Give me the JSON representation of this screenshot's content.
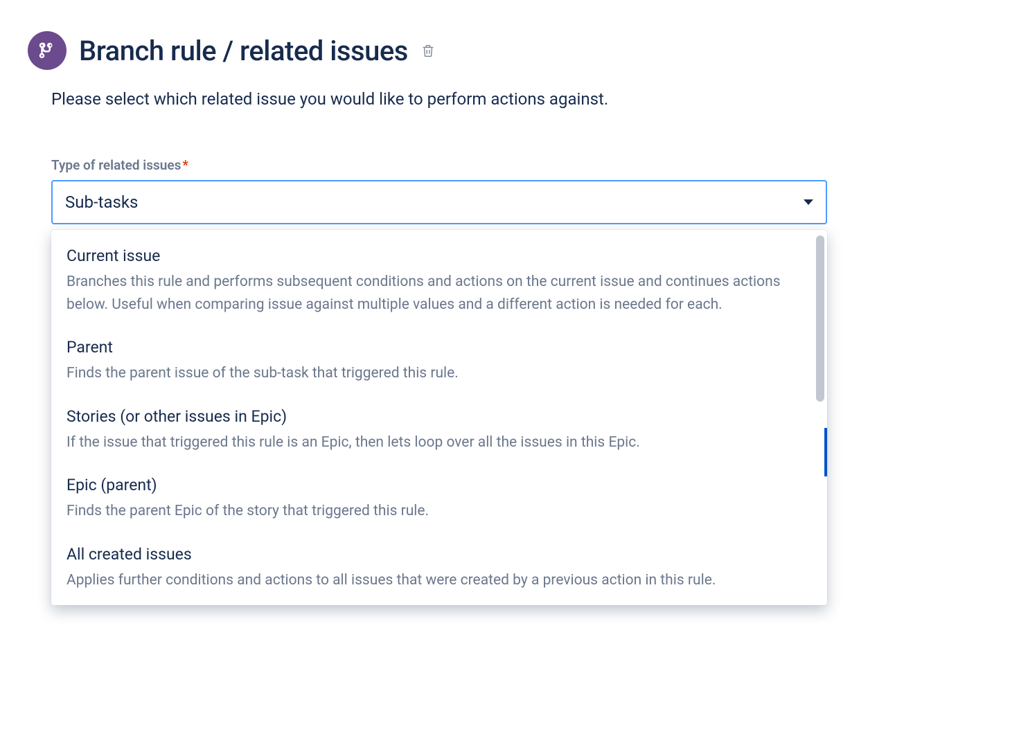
{
  "header": {
    "title": "Branch rule / related issues"
  },
  "description": "Please select which related issue you would like to perform actions against.",
  "field": {
    "label": "Type of related issues",
    "required_mark": "*",
    "selected_value": "Sub-tasks"
  },
  "options": [
    {
      "title": "Current issue",
      "description": "Branches this rule and performs subsequent conditions and actions on the current issue and continues actions below. Useful when comparing issue against multiple values and a different action is needed for each."
    },
    {
      "title": "Parent",
      "description": "Finds the parent issue of the sub-task that triggered this rule."
    },
    {
      "title": "Stories (or other issues in Epic)",
      "description": "If the issue that triggered this rule is an Epic, then lets loop over all the issues in this Epic."
    },
    {
      "title": "Epic (parent)",
      "description": "Finds the parent Epic of the story that triggered this rule."
    },
    {
      "title": "All created issues",
      "description": "Applies further conditions and actions to all issues that were created by a previous action in this rule."
    }
  ]
}
